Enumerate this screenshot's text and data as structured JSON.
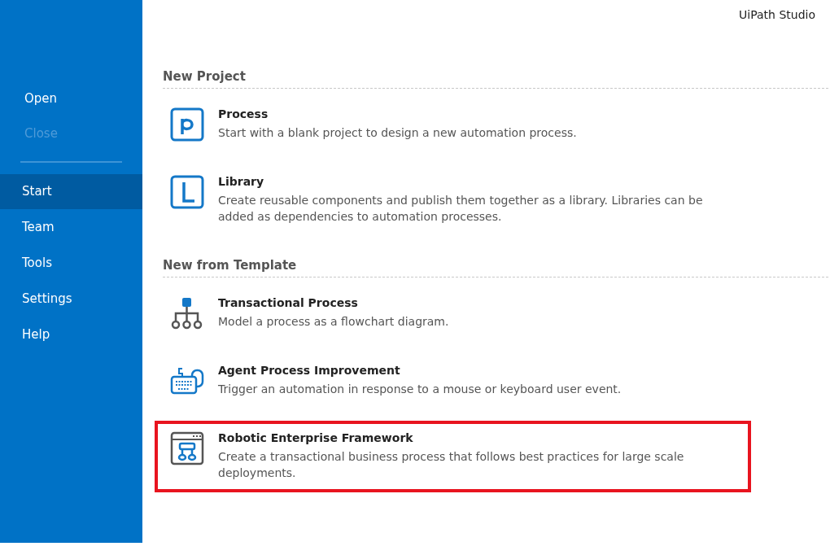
{
  "window": {
    "title": "UiPath Studio"
  },
  "sidebar": {
    "file_items": [
      {
        "label": "Open",
        "disabled": false
      },
      {
        "label": "Close",
        "disabled": true
      }
    ],
    "nav_items": [
      {
        "label": "Start",
        "selected": true
      },
      {
        "label": "Team",
        "selected": false
      },
      {
        "label": "Tools",
        "selected": false
      },
      {
        "label": "Settings",
        "selected": false
      },
      {
        "label": "Help",
        "selected": false
      }
    ]
  },
  "sections": [
    {
      "heading": "New Project",
      "items": [
        {
          "kind": "process",
          "title": "Process",
          "description": "Start with a blank project to design a new automation process.",
          "highlighted": false
        },
        {
          "kind": "library",
          "title": "Library",
          "description": "Create reusable components and publish them together as a library. Libraries can be added as dependencies to automation processes.",
          "highlighted": false
        }
      ]
    },
    {
      "heading": "New from Template",
      "items": [
        {
          "kind": "flowchart",
          "title": "Transactional Process",
          "description": "Model a process as a flowchart diagram.",
          "highlighted": false
        },
        {
          "kind": "agent",
          "title": "Agent Process Improvement",
          "description": "Trigger an automation in response to a mouse or keyboard user event.",
          "highlighted": false
        },
        {
          "kind": "framework",
          "title": "Robotic Enterprise Framework",
          "description": "Create a transactional business process that follows best practices for large scale deployments.",
          "highlighted": true
        }
      ]
    }
  ]
}
